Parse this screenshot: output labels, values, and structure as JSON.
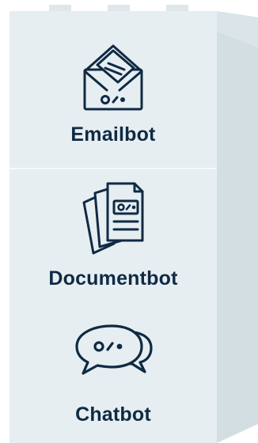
{
  "tiles": [
    {
      "label": "Emailbot",
      "icon": "envelope-bot-icon"
    },
    {
      "label": "Documentbot",
      "icon": "document-stack-bot-icon"
    },
    {
      "label": "Chatbot",
      "icon": "chat-bubbles-bot-icon"
    }
  ],
  "colors": {
    "front_face": "#e6eef2",
    "side_face": "#cfdbe1",
    "ink": "#102a43"
  }
}
